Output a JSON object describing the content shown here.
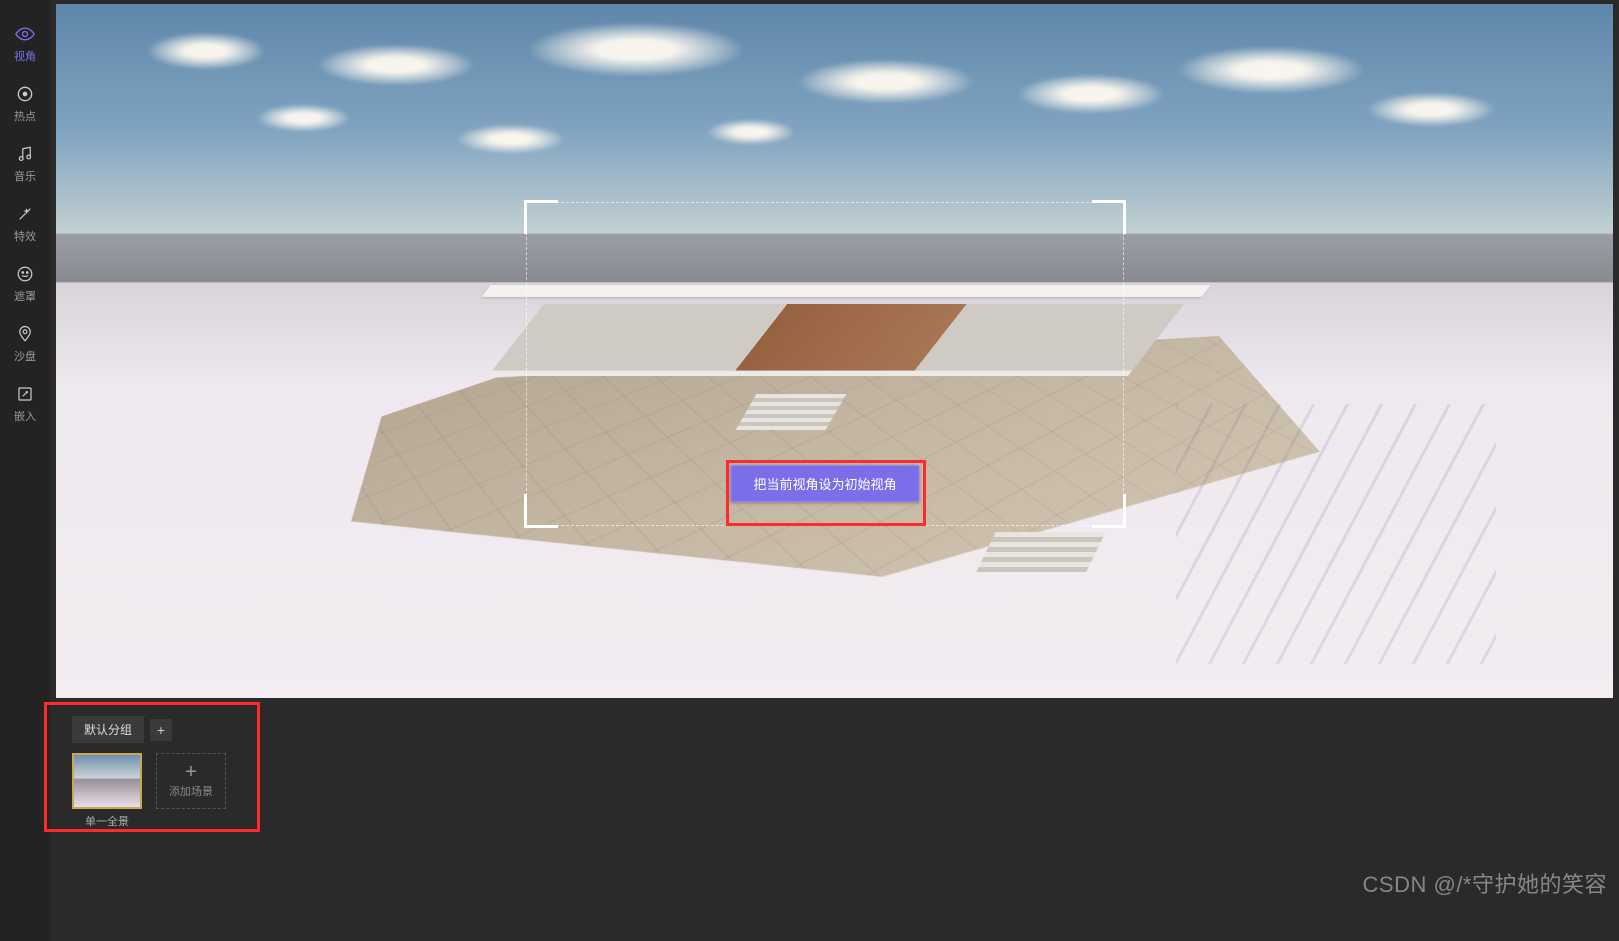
{
  "sidebar": {
    "items": [
      {
        "label": "视角",
        "icon": "eye-icon",
        "active": true
      },
      {
        "label": "热点",
        "icon": "target-icon",
        "active": false
      },
      {
        "label": "音乐",
        "icon": "music-icon",
        "active": false
      },
      {
        "label": "特效",
        "icon": "wand-icon",
        "active": false
      },
      {
        "label": "遮罩",
        "icon": "mask-icon",
        "active": false
      },
      {
        "label": "沙盘",
        "icon": "pin-icon",
        "active": false
      },
      {
        "label": "嵌入",
        "icon": "embed-icon",
        "active": false
      }
    ]
  },
  "viewport": {
    "set_initial_view_button": "把当前视角设为初始视角"
  },
  "bottom": {
    "default_group_tab": "默认分组",
    "add_group_label": "+",
    "scene_thumb_label": "单一全景",
    "add_scene_label": "添加场景",
    "add_scene_plus": "+"
  },
  "watermark": "CSDN @/*守护她的笑容"
}
